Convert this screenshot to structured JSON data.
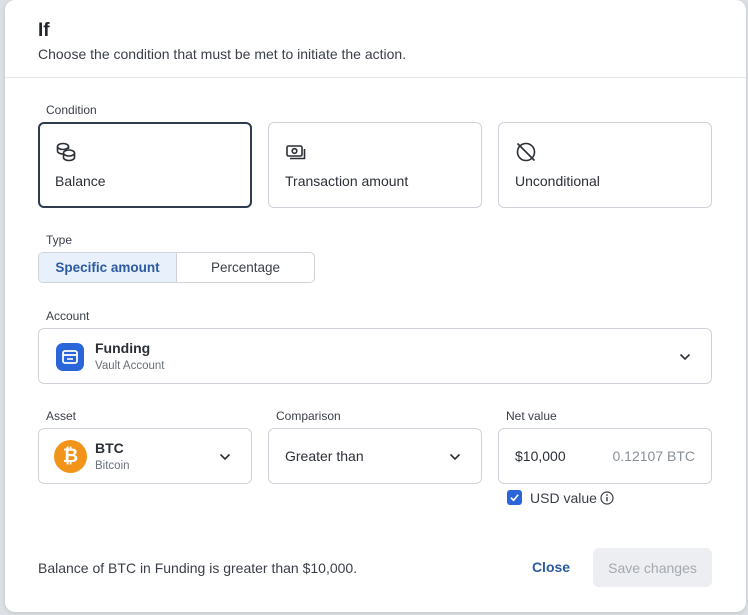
{
  "header": {
    "title": "If",
    "subtitle": "Choose the condition that must be met to initiate the action."
  },
  "condition": {
    "label": "Condition",
    "selected": "Balance",
    "options": [
      {
        "label": "Balance",
        "icon": "coins-stack-icon"
      },
      {
        "label": "Transaction amount",
        "icon": "cash-icon"
      },
      {
        "label": "Unconditional",
        "icon": "circle-slash-icon"
      }
    ]
  },
  "type": {
    "label": "Type",
    "options": [
      "Specific amount",
      "Percentage"
    ],
    "selected": "Specific amount"
  },
  "account": {
    "label": "Account",
    "name": "Funding",
    "subtype": "Vault Account",
    "icon": "vault-icon"
  },
  "asset": {
    "label": "Asset",
    "symbol": "BTC",
    "name": "Bitcoin",
    "icon_glyph": "₿"
  },
  "comparison": {
    "label": "Comparison",
    "value": "Greater than"
  },
  "net_value": {
    "label": "Net value",
    "usd": "$10,000",
    "btc": "0.12107 BTC",
    "usd_toggle_label": "USD value",
    "usd_toggle_checked": true
  },
  "footer": {
    "summary": "Balance of BTC in Funding is greater than $10,000.",
    "close_label": "Close",
    "save_label": "Save changes"
  },
  "colors": {
    "accent": "#2a66d9",
    "link": "#2c5aa0",
    "btc": "#f2931a",
    "selected_border": "#2e3a4e"
  }
}
